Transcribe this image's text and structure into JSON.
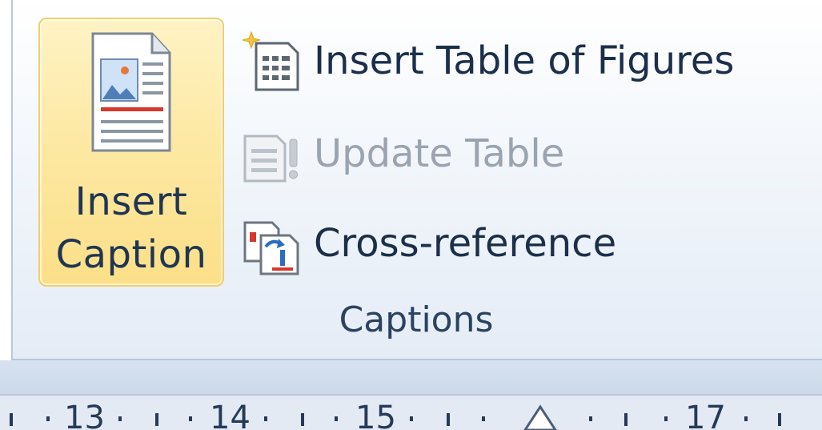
{
  "ribbon": {
    "big_button": {
      "label_line1": "Insert",
      "label_line2": "Caption",
      "icon": "document-picture-icon"
    },
    "commands": [
      {
        "label": "Insert Table of Figures",
        "icon": "table-of-figures-icon",
        "enabled": true
      },
      {
        "label": "Update Table",
        "icon": "update-table-icon",
        "enabled": false
      },
      {
        "label": "Cross-reference",
        "icon": "cross-reference-icon",
        "enabled": true
      }
    ],
    "group_title": "Captions"
  },
  "ruler": {
    "labels": [
      "13",
      "14",
      "15",
      "17"
    ]
  },
  "colors": {
    "highlight_fill": "#fde9a4",
    "highlight_border": "#f0cf6c",
    "text": "#1b2f4a",
    "disabled_text": "#9aa4b1",
    "ribbon_border": "#b9c9da"
  }
}
